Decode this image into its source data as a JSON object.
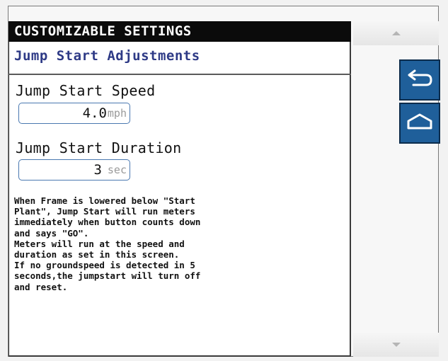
{
  "header": {
    "title": "CUSTOMIZABLE SETTINGS",
    "subtitle": "Jump Start Adjustments"
  },
  "fields": {
    "speed": {
      "label": "Jump Start Speed",
      "value": "4.0",
      "unit": "mph"
    },
    "duration": {
      "label": "Jump Start Duration",
      "value": "3",
      "unit": "sec"
    }
  },
  "description": "When Frame is lowered below \"Start\nPlant\", Jump Start will run meters\nimmediately when button counts down\nand says \"GO\".\nMeters will run at the speed and\nduration as set in this screen.\nIf no groundspeed is detected in 5\nseconds,the jumpstart will turn off\nand reset.",
  "icons": {
    "back": "back-arrow-icon",
    "home": "home-icon",
    "scroll_up": "scroll-up-icon",
    "scroll_down": "scroll-down-icon"
  },
  "colors": {
    "header_bg": "#0b0b0b",
    "subtitle": "#2e3a86",
    "nav_button": "#1f5f9a",
    "value_border": "#4a78b0"
  }
}
